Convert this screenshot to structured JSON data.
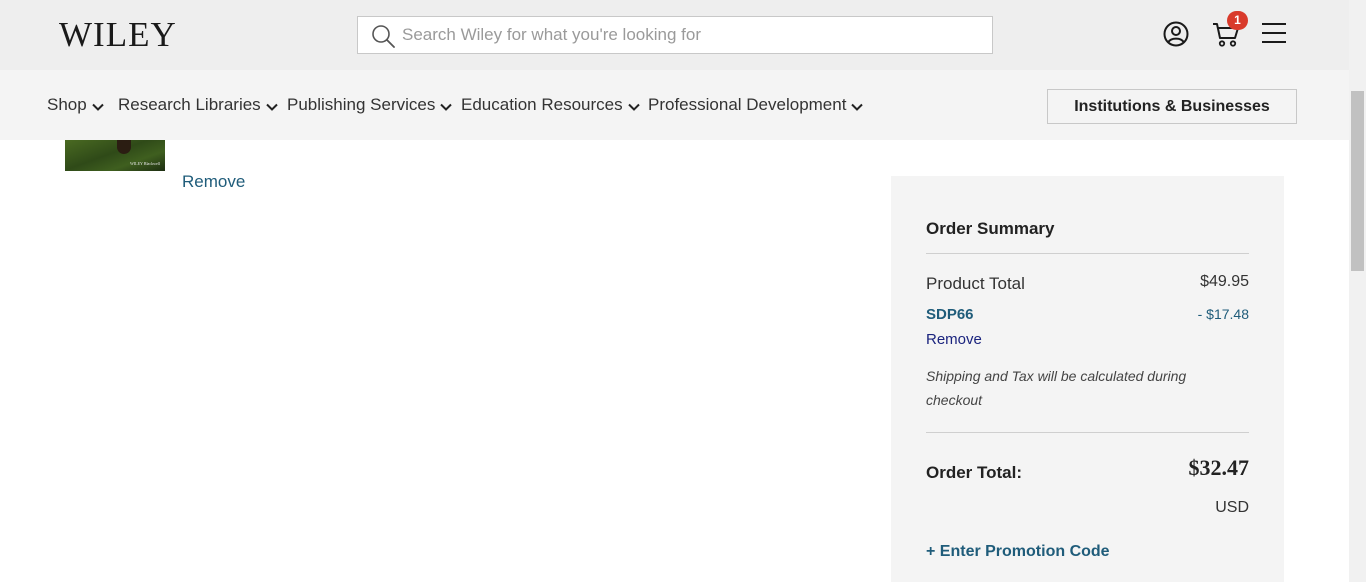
{
  "header": {
    "logo_text": "WILEY",
    "search": {
      "placeholder": "Search Wiley for what you're looking for",
      "value": ""
    },
    "icons": [
      "account-icon",
      "cart-icon",
      "menu-icon"
    ],
    "cart_count": "1"
  },
  "nav": {
    "items": [
      {
        "label": "Shop"
      },
      {
        "label": "Research Libraries"
      },
      {
        "label": "Publishing Services"
      },
      {
        "label": "Education Resources"
      },
      {
        "label": "Professional Development"
      }
    ],
    "institutions_button": "Institutions & Businesses"
  },
  "cart_item": {
    "thumbnail_brand": "WILEY Blackwell",
    "remove_label": "Remove"
  },
  "order_summary": {
    "title": "Order Summary",
    "product_total_label": "Product Total",
    "product_total_value": "$49.95",
    "promo_code": "SDP66",
    "promo_discount": "- $17.48",
    "promo_remove": "Remove",
    "shipping_note": "Shipping and Tax will be calculated during checkout",
    "order_total_label": "Order Total:",
    "order_total_value": "$32.47",
    "currency": "USD",
    "enter_promo": "+ Enter Promotion Code"
  },
  "colors": {
    "link": "#1f5c7a",
    "badge": "#d93a2b",
    "header_bg": "#eeeeee",
    "nav_bg": "#f4f4f4"
  }
}
